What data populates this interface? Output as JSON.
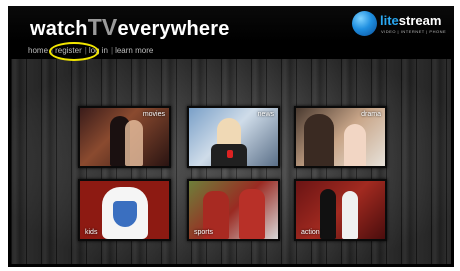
{
  "header": {
    "title_pre": "watch",
    "title_tv": "TV",
    "title_post": "everywhere",
    "brand": {
      "name_lite": "lite",
      "name_stream": "stream",
      "tagline": "VIDEO | INTERNET | PHONE"
    }
  },
  "nav": {
    "items": [
      {
        "label": "home"
      },
      {
        "label": "register"
      },
      {
        "label": "log in"
      },
      {
        "label": "learn more"
      }
    ],
    "separator": "|"
  },
  "colors": {
    "highlight_ring": "#f2e600",
    "brand_blue": "#2aa7f0"
  },
  "tiles": [
    {
      "label": "movies"
    },
    {
      "label": "news"
    },
    {
      "label": "drama"
    },
    {
      "label": "kids"
    },
    {
      "label": "sports"
    },
    {
      "label": "action"
    }
  ]
}
